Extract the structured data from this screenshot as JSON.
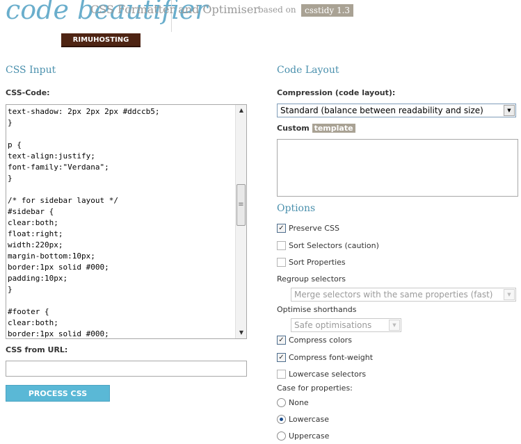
{
  "header": {
    "logo": "code beautifier",
    "tagline": "CSS Formatter and Optimiser",
    "based_on": "based on",
    "csstidy_link": "csstidy 1.3",
    "sponsor": "RIMUHOSTING"
  },
  "input": {
    "heading": "CSS Input",
    "code_label": "CSS-Code:",
    "code": "text-shadow: 2px 2px 2px #ddccb5;\n}\n\np {\ntext-align:justify;\nfont-family:\"Verdana\";\n}\n\n/* for sidebar layout */\n#sidebar {\nclear:both;\nfloat:right;\nwidth:220px;\nmargin-bottom:10px;\nborder:1px solid #000;\npadding:10px;\n}\n\n#footer {\nclear:both;\nborder:1px solid #000;",
    "url_label": "CSS from URL:",
    "url_value": "",
    "process_button": "PROCESS CSS"
  },
  "layout": {
    "heading": "Code Layout",
    "compression_label": "Compression (code layout):",
    "compression_value": "Standard (balance between readability and size)",
    "custom_label": "Custom",
    "template_label": "template",
    "template_value": ""
  },
  "options": {
    "heading": "Options",
    "preserve_css": {
      "label": "Preserve CSS",
      "checked": true
    },
    "sort_selectors": {
      "label": "Sort Selectors (caution)",
      "checked": false
    },
    "sort_properties": {
      "label": "Sort Properties",
      "checked": false
    },
    "regroup_label": "Regroup selectors",
    "regroup_value": "Merge selectors with the same properties (fast)",
    "shorthands_label": "Optimise shorthands",
    "shorthands_value": "Safe optimisations",
    "compress_colors": {
      "label": "Compress colors",
      "checked": true
    },
    "compress_font_weight": {
      "label": "Compress font-weight",
      "checked": true
    },
    "lowercase_selectors": {
      "label": "Lowercase selectors",
      "checked": false
    },
    "case_label": "Case for properties:",
    "case_options": [
      {
        "label": "None",
        "selected": false
      },
      {
        "label": "Lowercase",
        "selected": true
      },
      {
        "label": "Uppercase",
        "selected": false
      }
    ]
  },
  "icons": {
    "scroll_up": "triangle-up",
    "scroll_down": "triangle-down",
    "dropdown": "triangle-down"
  },
  "colors": {
    "accent": "#4a90ad",
    "logo": "#6aaecc",
    "button": "#5ab8d6",
    "badge": "#a9a294",
    "sponsor": "#4e2413"
  }
}
